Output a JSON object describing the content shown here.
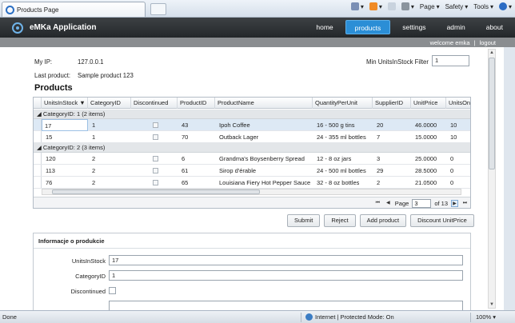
{
  "browser": {
    "tab_title": "Products Page",
    "commands": {
      "page": "Page",
      "safety": "Safety",
      "tools": "Tools"
    }
  },
  "app": {
    "title": "eMKa Application",
    "nav": [
      "home",
      "products",
      "settings",
      "admin",
      "about"
    ],
    "active_nav": "products",
    "welcome": "welcome emka",
    "sep": "|",
    "logout": "logout"
  },
  "info": {
    "ip_label": "My IP:",
    "ip_value": "127.0.0.1",
    "last_label": "Last product:",
    "last_value": "Sample product 123",
    "filter_label": "Min UnitsInStock Filter",
    "filter_value": "1"
  },
  "page_heading": "Products",
  "grid": {
    "columns": [
      "UnitsInStock",
      "CategoryID",
      "Discontinued",
      "ProductID",
      "ProductName",
      "QuantityPerUnit",
      "SupplierID",
      "UnitPrice",
      "UnitsOn"
    ],
    "sort_indicator": "▼",
    "groups": [
      {
        "label": "CategoryID: 1 (2 items)",
        "rows": [
          [
            "17",
            "1",
            "",
            "43",
            "Ipoh Coffee",
            "16 - 500 g tins",
            "20",
            "46.0000",
            "10"
          ],
          [
            "15",
            "1",
            "",
            "70",
            "Outback Lager",
            "24 - 355 ml bottles",
            "7",
            "15.0000",
            "10"
          ]
        ]
      },
      {
        "label": "CategoryID: 2 (3 items)",
        "rows": [
          [
            "120",
            "2",
            "",
            "6",
            "Grandma's Boysenberry Spread",
            "12 - 8 oz jars",
            "3",
            "25.0000",
            "0"
          ],
          [
            "113",
            "2",
            "",
            "61",
            "Sirop d'érable",
            "24 - 500 ml bottles",
            "29",
            "28.5000",
            "0"
          ],
          [
            "76",
            "2",
            "",
            "65",
            "Louisiana Fiery Hot Pepper Sauce",
            "32 - 8 oz bottles",
            "2",
            "21.0500",
            "0"
          ]
        ]
      }
    ],
    "pager": {
      "page_label": "Page",
      "page_value": "3",
      "of_label": "of 13"
    }
  },
  "buttons": [
    "Submit",
    "Reject",
    "Add product",
    "Discount UnitPrice"
  ],
  "panel": {
    "title": "Informacje o produkcie",
    "fields": [
      {
        "label": "UnitsInStock",
        "value": "17"
      },
      {
        "label": "CategoryID",
        "value": "1"
      },
      {
        "label": "Discontinued",
        "value": ""
      }
    ]
  },
  "status": {
    "left": "Done",
    "zone": "Internet | Protected Mode: On",
    "zoom": "100%"
  }
}
